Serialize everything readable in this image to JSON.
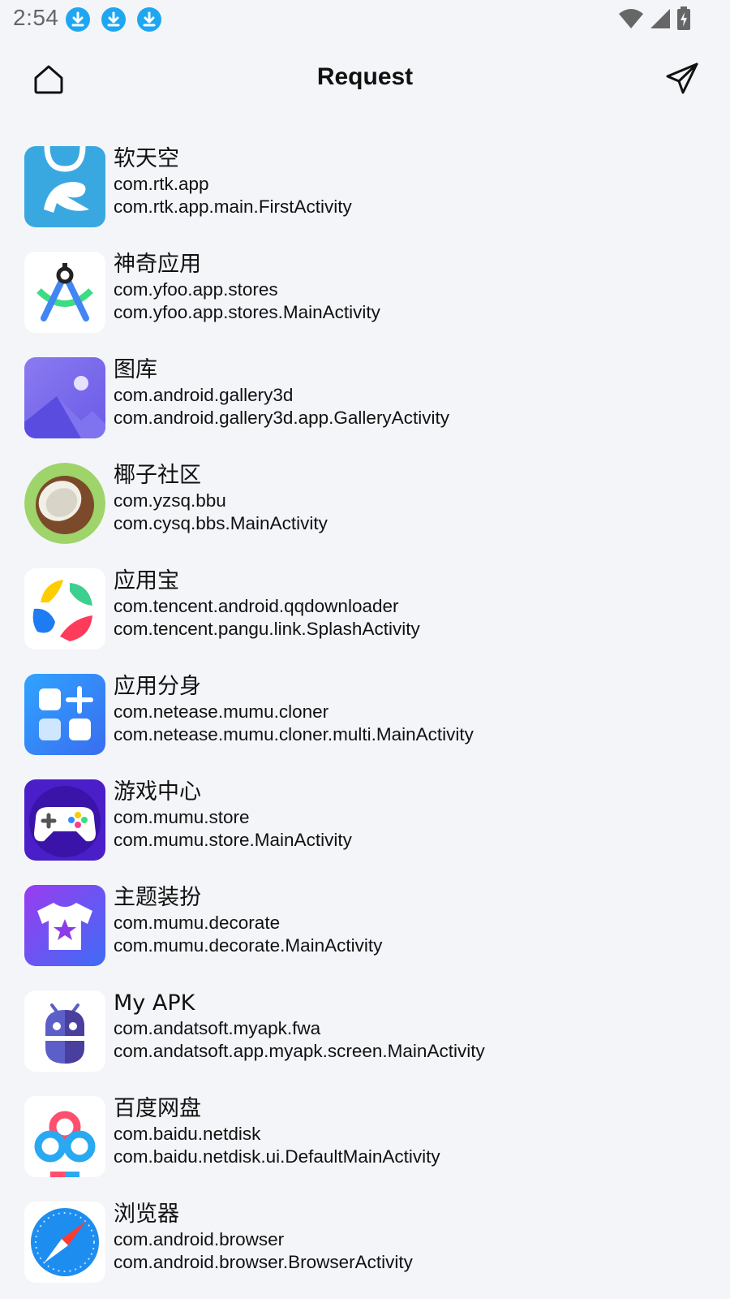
{
  "status": {
    "time": "2:54",
    "notifications": [
      "download-icon",
      "download-icon",
      "download-icon"
    ],
    "system_icons": [
      "wifi-icon",
      "signal-icon",
      "battery-charging-icon"
    ]
  },
  "app_bar": {
    "title": "Request",
    "left_icon": "home-icon",
    "right_icon": "send-icon"
  },
  "apps": [
    {
      "name": "软天空",
      "package": "com.rtk.app",
      "activity": "com.rtk.app.main.FirstActivity",
      "icon": "rtk-app-icon"
    },
    {
      "name": "神奇应用",
      "package": "com.yfoo.app.stores",
      "activity": "com.yfoo.app.stores.MainActivity",
      "icon": "yfoo-app-icon"
    },
    {
      "name": "图库",
      "package": "com.android.gallery3d",
      "activity": "com.android.gallery3d.app.GalleryActivity",
      "icon": "gallery-icon"
    },
    {
      "name": "椰子社区",
      "package": "com.yzsq.bbu",
      "activity": "com.cysq.bbs.MainActivity",
      "icon": "coconut-icon"
    },
    {
      "name": "应用宝",
      "package": "com.tencent.android.qqdownloader",
      "activity": "com.tencent.pangu.link.SplashActivity",
      "icon": "yingyongbao-icon"
    },
    {
      "name": "应用分身",
      "package": "com.netease.mumu.cloner",
      "activity": "com.netease.mumu.cloner.multi.MainActivity",
      "icon": "app-cloner-icon"
    },
    {
      "name": "游戏中心",
      "package": "com.mumu.store",
      "activity": "com.mumu.store.MainActivity",
      "icon": "game-center-icon"
    },
    {
      "name": "主题装扮",
      "package": "com.mumu.decorate",
      "activity": "com.mumu.decorate.MainActivity",
      "icon": "theme-tshirt-icon"
    },
    {
      "name": "My APK",
      "package": "com.andatsoft.myapk.fwa",
      "activity": "com.andatsoft.app.myapk.screen.MainActivity",
      "icon": "myapk-robot-icon"
    },
    {
      "name": "百度网盘",
      "package": "com.baidu.netdisk",
      "activity": "com.baidu.netdisk.ui.DefaultMainActivity",
      "icon": "baidu-netdisk-icon"
    },
    {
      "name": "浏览器",
      "package": "com.android.browser",
      "activity": "com.android.browser.BrowserActivity",
      "icon": "compass-browser-icon"
    }
  ]
}
